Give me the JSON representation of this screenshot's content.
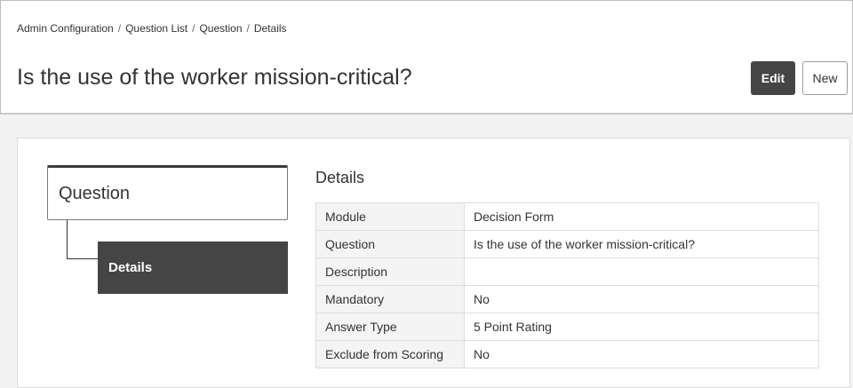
{
  "breadcrumb": {
    "items": [
      "Admin Configuration",
      "Question List",
      "Question",
      "Details"
    ],
    "separator": "/"
  },
  "page": {
    "title": "Is the use of the worker mission-critical?"
  },
  "actions": {
    "edit_label": "Edit",
    "new_label": "New"
  },
  "tree": {
    "root_label": "Question",
    "child_label": "Details"
  },
  "details": {
    "title": "Details",
    "rows": [
      {
        "label": "Module",
        "value": "Decision Form"
      },
      {
        "label": "Question",
        "value": "Is the use of the worker mission-critical?"
      },
      {
        "label": "Description",
        "value": ""
      },
      {
        "label": "Mandatory",
        "value": "No"
      },
      {
        "label": "Answer Type",
        "value": "5 Point Rating"
      },
      {
        "label": "Exclude from Scoring",
        "value": "No"
      }
    ]
  },
  "colors": {
    "dark_button": "#454545",
    "background": "#f2f2f2",
    "table_key_bg": "#f4f4f4"
  }
}
